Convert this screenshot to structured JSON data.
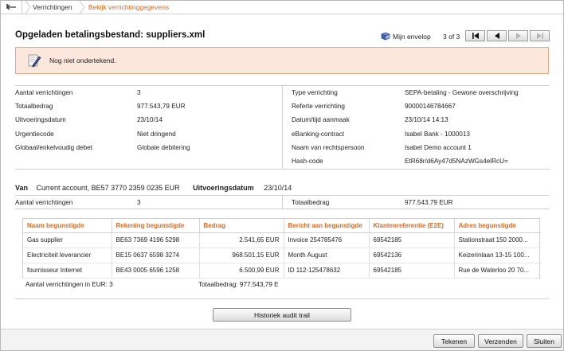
{
  "breadcrumb": {
    "items": [
      "Verrichtingen",
      "Bekijk verrichtinggegevens"
    ]
  },
  "header": {
    "title": "Opgeladen betalingsbestand: suppliers.xml",
    "envelope_label": "Mijn envelop",
    "pager_text": "3 of 3"
  },
  "warning": {
    "text": "Nog niet ondertekend."
  },
  "details_left": [
    {
      "label": "Aantal verrichtingen",
      "value": "3"
    },
    {
      "label": "Totaalbedrag",
      "value": "977.543,79 EUR"
    },
    {
      "label": "Uitvoeringsdatum",
      "value": "23/10/14"
    },
    {
      "label": "Urgentiecode",
      "value": "Niet dringend"
    },
    {
      "label": "Globaal/enkelvoudig debet",
      "value": "Globale debitering"
    }
  ],
  "details_right": [
    {
      "label": "Type verrichting",
      "value": "SEPA-betaling - Gewone overschrijving"
    },
    {
      "label": "Referte verrichting",
      "value": "90000146784667"
    },
    {
      "label": "Datum/tijd aanmaak",
      "value": "23/10/14 14:13"
    },
    {
      "label": "eBanking-contract",
      "value": "Isabel Bank - 1000013"
    },
    {
      "label": "Naam van rechtspersoon",
      "value": "Isabel Demo account 1"
    },
    {
      "label": "Hash-code",
      "value": "EtR68r/d6Ay47d5NAzWGs4elRcU="
    }
  ],
  "van": {
    "label": "Van",
    "account": "Current account, BE57 3770 2359 0235 EUR",
    "date_label": "Uitvoeringsdatum",
    "date_value": "23/10/14"
  },
  "summary": {
    "count_label": "Aantal verrichtingen",
    "count_value": "3",
    "total_label": "Totaalbedrag",
    "total_value": "977.543,79 EUR"
  },
  "table": {
    "headers": [
      "Naam begunstigde",
      "Rekening begunstigde",
      "Bedrag",
      "Bericht aan begunstigde",
      "Klantenreferentie (E2E)",
      "Adres begunstigde"
    ],
    "rows": [
      [
        "Gas supplier",
        "BE63 7369 4196 5298",
        "2.541,65 EUR",
        "Invoice 254785476",
        "69542185",
        "Stationstraat 150 2000..."
      ],
      [
        "Electriciteit leverancier",
        "BE15 0637 6598 3274",
        "968.501,15 EUR",
        "Month August",
        "69542136",
        "Keizerinlaan 13-15 100..."
      ],
      [
        "fournisseur Internet",
        "BE43 0005 6596 1258",
        "6.500,99 EUR",
        "ID 112-125478632",
        "69542185",
        "Rue de Waterloo 20 70..."
      ]
    ]
  },
  "table_footer": {
    "count": "Aantal verrichtingen in EUR: 3",
    "total": "Totaalbedrag: 977.543,79 E"
  },
  "buttons": {
    "audit": "Historiek audit trail",
    "sign": "Tekenen",
    "send": "Verzenden",
    "close": "Sluiten"
  }
}
